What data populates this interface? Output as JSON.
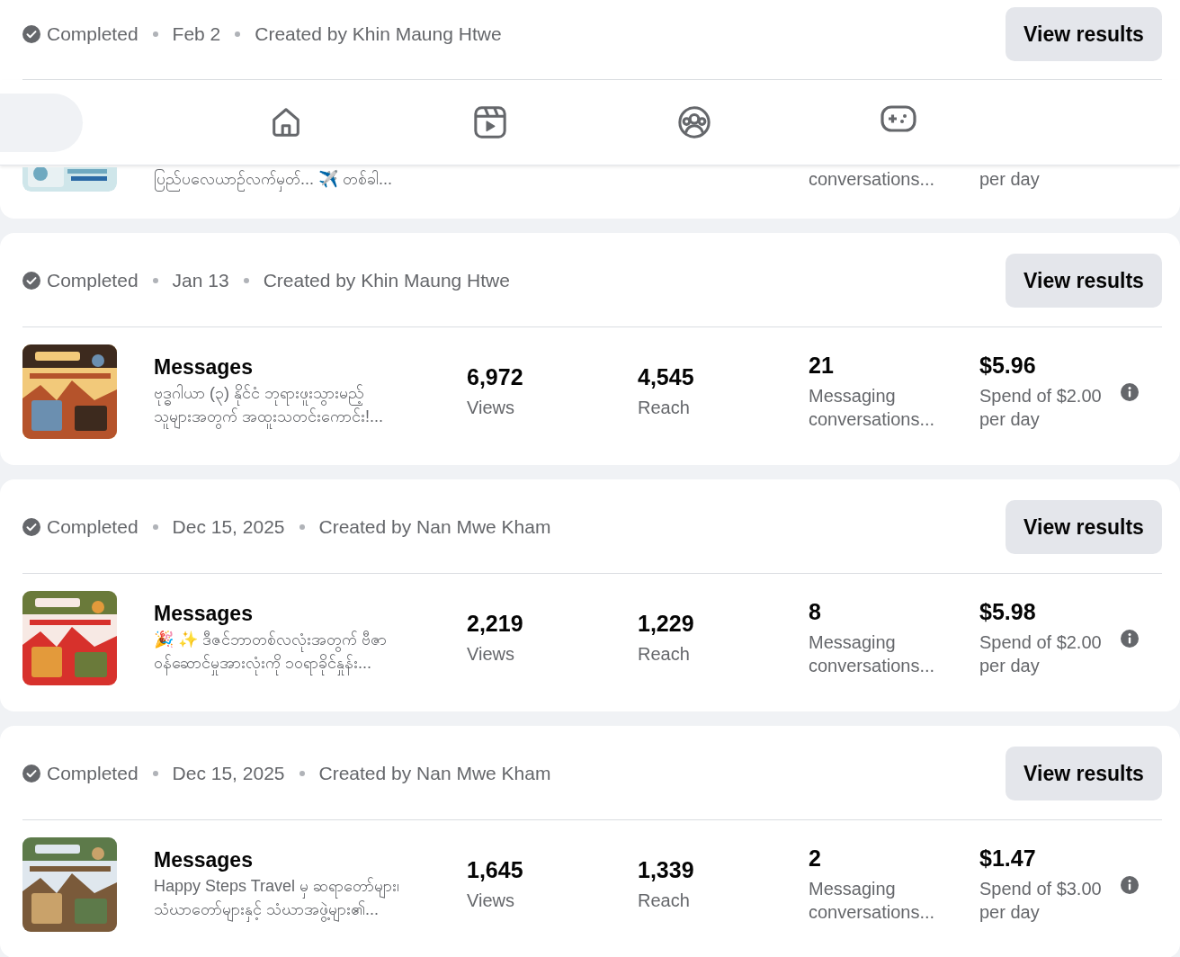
{
  "nav": {
    "items": [
      {
        "kind": "home"
      },
      {
        "kind": "video"
      },
      {
        "kind": "people"
      },
      {
        "kind": "gaming"
      }
    ]
  },
  "campaigns": [
    {
      "status": "Completed",
      "date": "Feb 2",
      "creator": "Created by Khin Maung Htwe",
      "action": "View results",
      "ad": {
        "obscured": true,
        "description_lines": [
          "ပြည်ပလေယာဉ်လက်မှတ်... ✈️ တစ်ခါ..."
        ],
        "results_label_lines": [
          "conversations..."
        ],
        "budget_lines": [
          "per day"
        ]
      }
    },
    {
      "status": "Completed",
      "date": "Jan 13",
      "creator": "Created by Khin Maung Htwe",
      "action": "View results",
      "ad": {
        "obscured": false,
        "type": "Messages",
        "description_lines": [
          "ဗုဒ္ဓဂါယာ (၃) နိုင်ငံ ဘုရားဖူးသွားမည့်",
          "သူများအတွက် အထူးသတင်းကောင်း!..."
        ],
        "views": "6,972",
        "views_label": "Views",
        "reach": "4,545",
        "reach_label": "Reach",
        "results": "21",
        "results_label_lines": [
          "Messaging",
          "conversations..."
        ],
        "spent": "$5.96",
        "budget_lines": [
          "Spend of $2.00",
          "per day"
        ]
      }
    },
    {
      "status": "Completed",
      "date": "Dec 15, 2025",
      "creator": "Created by Nan Mwe Kham",
      "action": "View results",
      "ad": {
        "obscured": false,
        "type": "Messages",
        "description_lines": [
          "🎉 ✨ ဒီဇင်ဘာတစ်လလုံးအတွက် ဗီဇာ",
          "ဝန်ဆောင်မှုအားလုံးကို ၁၀ရာခိုင်နှုန်း..."
        ],
        "views": "2,219",
        "views_label": "Views",
        "reach": "1,229",
        "reach_label": "Reach",
        "results": "8",
        "results_label_lines": [
          "Messaging",
          "conversations..."
        ],
        "spent": "$5.98",
        "budget_lines": [
          "Spend of $2.00",
          "per day"
        ]
      }
    },
    {
      "status": "Completed",
      "date": "Dec 15, 2025",
      "creator": "Created by Nan Mwe Kham",
      "action": "View results",
      "ad": {
        "obscured": false,
        "type": "Messages",
        "description_lines": [
          "Happy Steps Travel မှ ဆရာတော်များ၊",
          "သံဃာတော်များနှင့် သံဃာအဖွဲ့များ၏..."
        ],
        "views": "1,645",
        "views_label": "Views",
        "reach": "1,339",
        "reach_label": "Reach",
        "results": "2",
        "results_label_lines": [
          "Messaging",
          "conversations..."
        ],
        "spent": "$1.47",
        "budget_lines": [
          "Spend of $3.00",
          "per day"
        ]
      }
    }
  ]
}
